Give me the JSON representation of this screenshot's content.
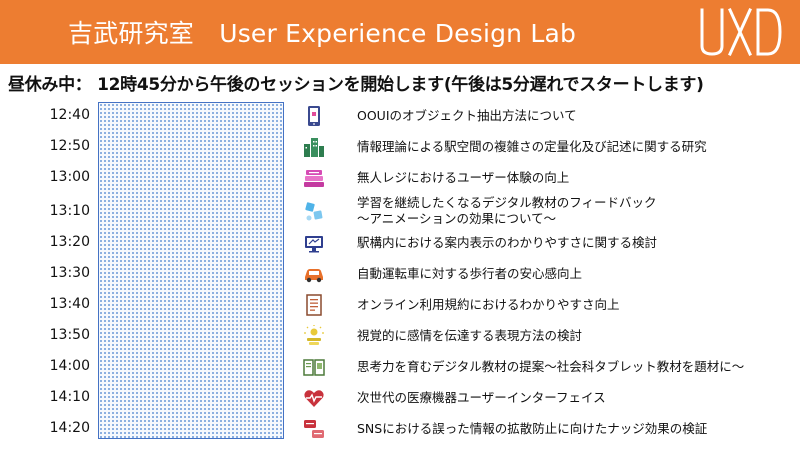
{
  "header": {
    "title": "吉武研究室　User Experience Design Lab",
    "logo_text": "UXD"
  },
  "notice": "昼休み中：  12時45分から午後のセッションを開始します(午後は5分遅れでスタートします)",
  "schedule": [
    {
      "time": "12:40",
      "icon": "tablet-icon",
      "title": "OOUIのオブジェクト抽出方法について",
      "subtitle": ""
    },
    {
      "time": "12:50",
      "icon": "city-buildings-icon",
      "title": "情報理論による駅空間の複雑さの定量化及び記述に関する研究",
      "subtitle": ""
    },
    {
      "time": "13:00",
      "icon": "cash-register-icon",
      "title": "無人レジにおけるユーザー体験の向上",
      "subtitle": ""
    },
    {
      "time": "13:10",
      "icon": "learning-feedback-icon",
      "title": "学習を継続したくなるデジタル教材のフィードバック",
      "subtitle": "～アニメーションの効果について～"
    },
    {
      "time": "13:20",
      "icon": "station-display-icon",
      "title": "駅構内における案内表示のわかりやすさに関する検討",
      "subtitle": ""
    },
    {
      "time": "13:30",
      "icon": "car-icon",
      "title": "自動運転車に対する歩行者の安心感向上",
      "subtitle": ""
    },
    {
      "time": "13:40",
      "icon": "document-icon",
      "title": "オンライン利用規約におけるわかりやすさ向上",
      "subtitle": ""
    },
    {
      "time": "13:50",
      "icon": "emotion-expression-icon",
      "title": "視覚的に感情を伝達する表現方法の検討",
      "subtitle": ""
    },
    {
      "time": "14:00",
      "icon": "book-icon",
      "title": "思考力を育むデジタル教材の提案～社会科タブレット教材を題材に～",
      "subtitle": ""
    },
    {
      "time": "14:10",
      "icon": "heart-pulse-icon",
      "title": "次世代の医療機器ユーザーインターフェイス",
      "subtitle": ""
    },
    {
      "time": "14:20",
      "icon": "sns-chat-icon",
      "title": "SNSにおける誤った情報の拡散防止に向けたナッジ効果の検証",
      "subtitle": ""
    }
  ],
  "colors": {
    "header_bg": "#ed7d31",
    "header_text": "#ffffff",
    "slot_border": "#4472c4",
    "slot_dots": "#6f9bd8"
  }
}
